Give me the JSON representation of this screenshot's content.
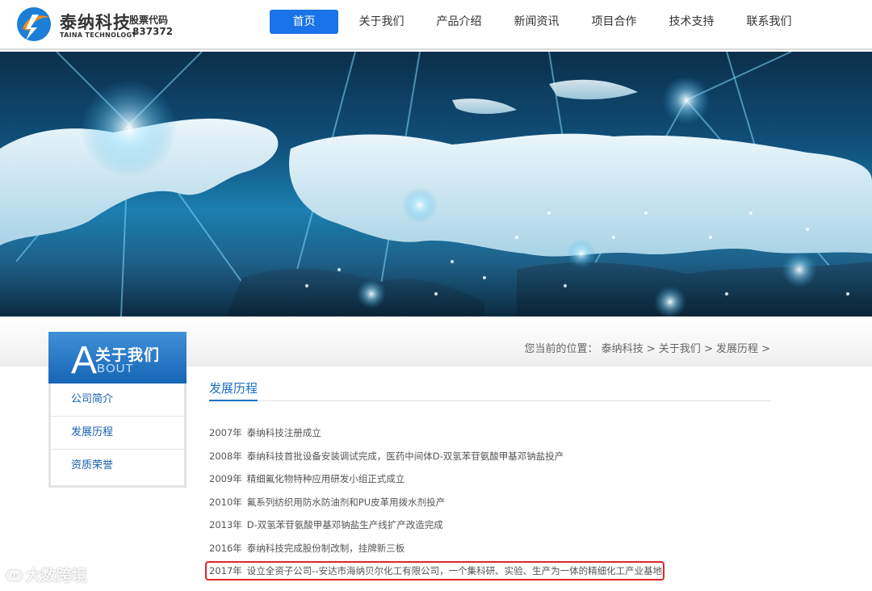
{
  "brand": {
    "name": "泰纳科技",
    "name_en": "TAINA TECHNOLOGY",
    "stock_label": "股票代码",
    "stock_code": "837372"
  },
  "nav": {
    "items": [
      {
        "label": "首页",
        "active": true
      },
      {
        "label": "关于我们"
      },
      {
        "label": "产品介绍"
      },
      {
        "label": "新闻资讯"
      },
      {
        "label": "项目合作"
      },
      {
        "label": "技术支持"
      },
      {
        "label": "联系我们"
      }
    ]
  },
  "sidebar": {
    "title_letter": "A",
    "title_cn": "关于我们",
    "title_en": "BOUT",
    "items": [
      {
        "label": "公司简介"
      },
      {
        "label": "发展历程"
      },
      {
        "label": "资质荣誉"
      }
    ]
  },
  "breadcrumb": {
    "text": "您当前的位置：  泰纳科技 > 关于我们 > 发展历程 >"
  },
  "section": {
    "title": "发展历程"
  },
  "timeline": [
    {
      "year": "2007年",
      "text": "泰纳科技注册成立"
    },
    {
      "year": "2008年",
      "text": "泰纳科技首批设备安装调试完成，医药中间体D-双氢苯苷氨酸甲基邓钠盐投产"
    },
    {
      "year": "2009年",
      "text": "精细氟化物特种应用研发小组正式成立"
    },
    {
      "year": "2010年",
      "text": "氟系列纺织用防水防油剂和PU皮革用拨水剂投产"
    },
    {
      "year": "2013年",
      "text": "D-双氢苯苷氨酸甲基邓钠盐生产线扩产改造完成"
    },
    {
      "year": "2016年",
      "text": "泰纳科技完成股份制改制，挂牌新三板"
    },
    {
      "year": "2017年",
      "text": "设立全资子公司--安达市海纳贝尔化工有限公司，一个集科研、实验、生产为一体的精细化工产业基地"
    }
  ],
  "watermark": {
    "text": "大数跨境"
  },
  "colors": {
    "accent": "#1a73e8",
    "link": "#1a5fb0",
    "highlight": "#e0262a"
  }
}
